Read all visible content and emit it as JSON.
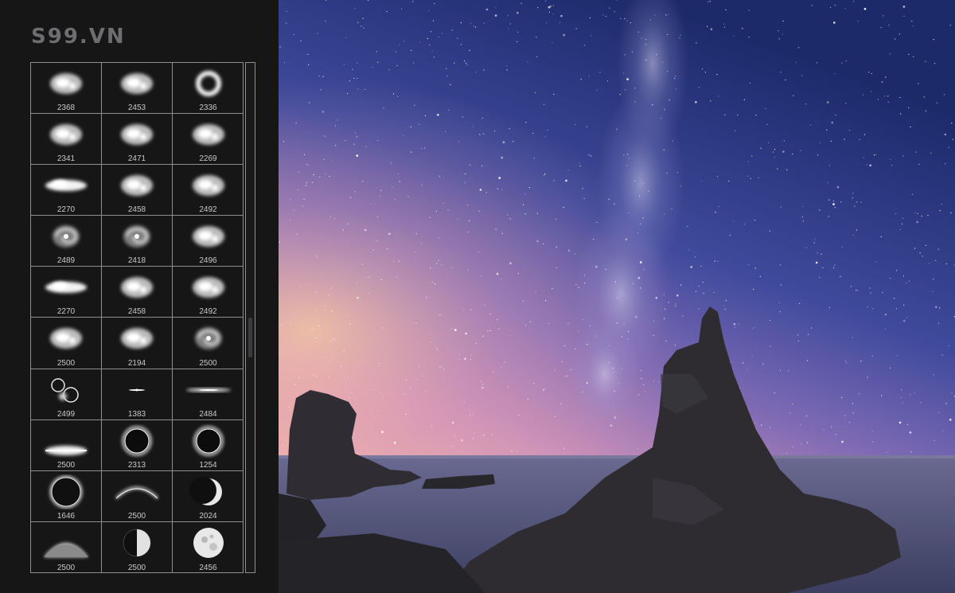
{
  "brand": "S99.VN",
  "brushes": [
    {
      "num": "2368",
      "icon": "nebula-brush-icon"
    },
    {
      "num": "2453",
      "icon": "nebula-brush-icon"
    },
    {
      "num": "2336",
      "icon": "nebula-ring-brush-icon"
    },
    {
      "num": "2341",
      "icon": "nebula-brush-icon"
    },
    {
      "num": "2471",
      "icon": "nebula-brush-icon"
    },
    {
      "num": "2269",
      "icon": "nebula-brush-icon"
    },
    {
      "num": "2270",
      "icon": "cloud-brush-icon"
    },
    {
      "num": "2458",
      "icon": "nebula-brush-icon"
    },
    {
      "num": "2492",
      "icon": "nebula-brush-icon"
    },
    {
      "num": "2489",
      "icon": "galaxy-brush-icon"
    },
    {
      "num": "2418",
      "icon": "galaxy-brush-icon"
    },
    {
      "num": "2496",
      "icon": "nebula-brush-icon"
    },
    {
      "num": "2270",
      "icon": "cloud-brush-icon"
    },
    {
      "num": "2458",
      "icon": "nebula-brush-icon"
    },
    {
      "num": "2492",
      "icon": "nebula-brush-icon"
    },
    {
      "num": "2500",
      "icon": "nebula-brush-icon"
    },
    {
      "num": "2194",
      "icon": "nebula-brush-icon"
    },
    {
      "num": "2500",
      "icon": "galaxy-brush-icon"
    },
    {
      "num": "2499",
      "icon": "planets-brush-icon"
    },
    {
      "num": "1383",
      "icon": "star-flare-brush-icon"
    },
    {
      "num": "2484",
      "icon": "lens-flare-brush-icon"
    },
    {
      "num": "2500",
      "icon": "horizon-glow-brush-icon"
    },
    {
      "num": "2313",
      "icon": "eclipse-brush-icon"
    },
    {
      "num": "1254",
      "icon": "eclipse-brush-icon"
    },
    {
      "num": "1646",
      "icon": "planet-brush-icon"
    },
    {
      "num": "2500",
      "icon": "planet-arc-brush-icon"
    },
    {
      "num": "2024",
      "icon": "crescent-moon-brush-icon"
    },
    {
      "num": "2500",
      "icon": "planet-horizon-brush-icon"
    },
    {
      "num": "2500",
      "icon": "half-moon-brush-icon"
    },
    {
      "num": "2456",
      "icon": "full-moon-brush-icon"
    }
  ],
  "colors": {
    "panel_bg": "#161617",
    "grid_line": "#8f8f8f",
    "sky_top": "#1d2a66",
    "sky_mid": "#5a5aa6",
    "horizon": "#e8a8b8",
    "sea": "#4b4f72",
    "rock": "#2b2a2e"
  }
}
